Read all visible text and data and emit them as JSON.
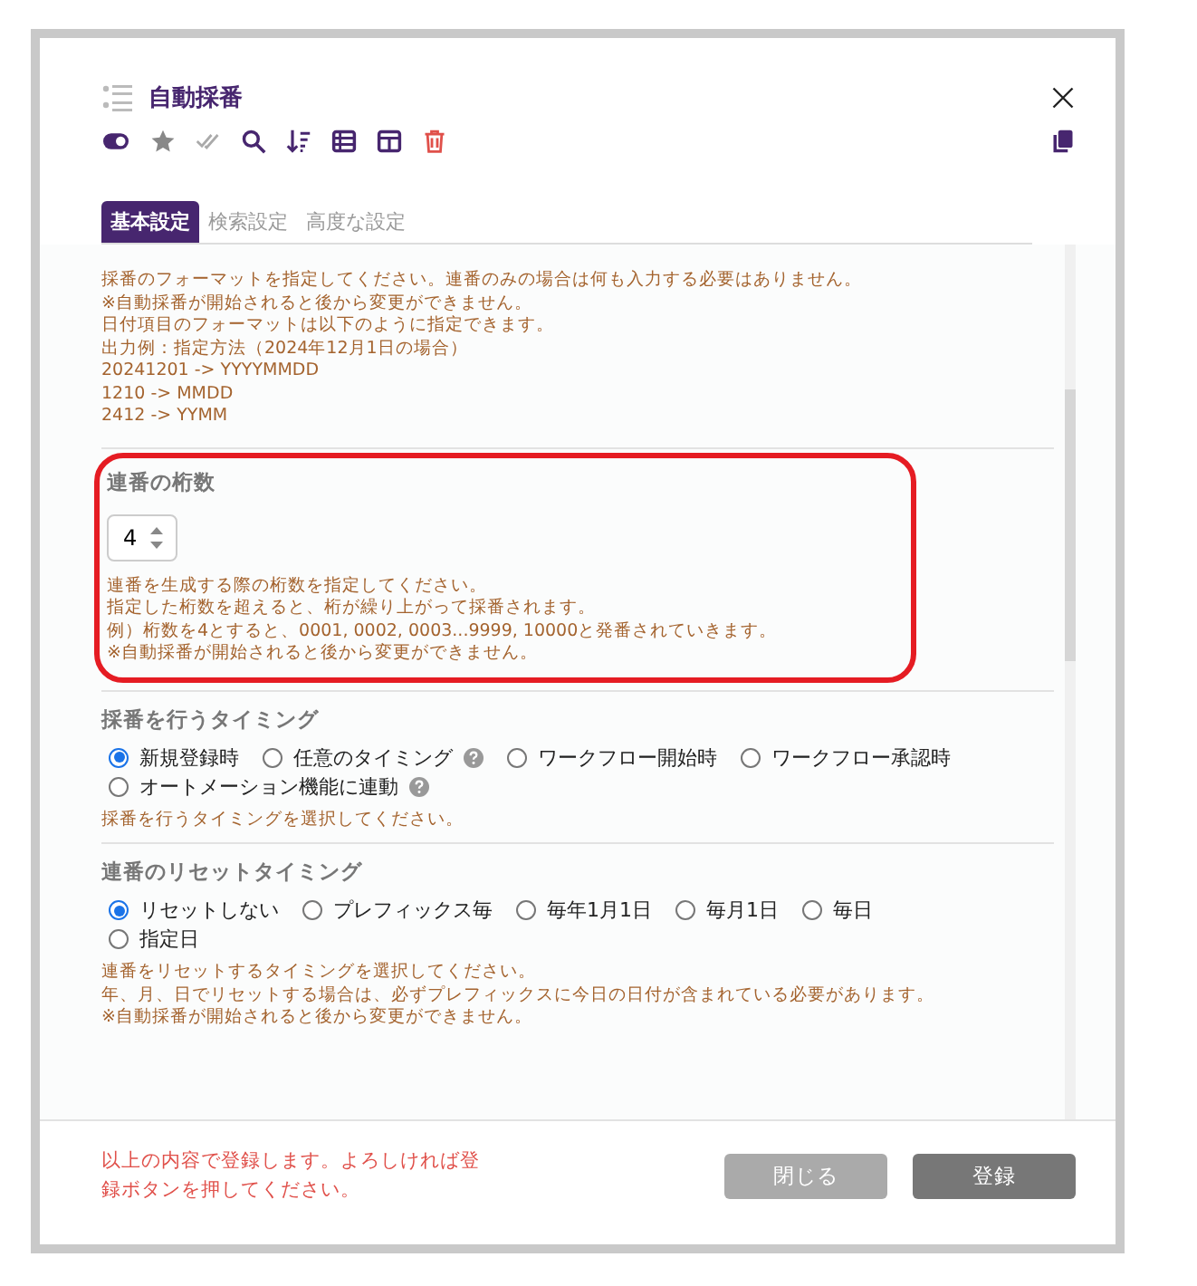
{
  "dialog": {
    "title": "自動採番"
  },
  "tabs": [
    {
      "label": "基本設定",
      "selected": true
    },
    {
      "label": "検索設定",
      "selected": false
    },
    {
      "label": "高度な設定",
      "selected": false
    }
  ],
  "format_help": [
    "採番のフォーマットを指定してください。連番のみの場合は何も入力する必要はありません。",
    "※自動採番が開始されると後から変更ができません。",
    "日付項目のフォーマットは以下のように指定できます。",
    "出力例：指定方法（2024年12月1日の場合）",
    "20241201 -> YYYYMMDD",
    "1210 -> MMDD",
    "2412 -> YYMM"
  ],
  "digits": {
    "label": "連番の桁数",
    "value": "4",
    "help": [
      "連番を生成する際の桁数を指定してください。",
      "指定した桁数を超えると、桁が繰り上がって採番されます。",
      "例）桁数を4とすると、0001, 0002, 0003...9999, 10000と発番されていきます。",
      "※自動採番が開始されると後から変更ができません。"
    ]
  },
  "timing": {
    "label": "採番を行うタイミング",
    "options": [
      {
        "label": "新規登録時",
        "selected": true,
        "help": false
      },
      {
        "label": "任意のタイミング",
        "selected": false,
        "help": true
      },
      {
        "label": "ワークフロー開始時",
        "selected": false,
        "help": false
      },
      {
        "label": "ワークフロー承認時",
        "selected": false,
        "help": false
      },
      {
        "label": "オートメーション機能に連動",
        "selected": false,
        "help": true
      }
    ],
    "help": [
      "採番を行うタイミングを選択してください。"
    ]
  },
  "reset": {
    "label": "連番のリセットタイミング",
    "options": [
      {
        "label": "リセットしない",
        "selected": true,
        "help": false
      },
      {
        "label": "プレフィックス毎",
        "selected": false,
        "help": false
      },
      {
        "label": "毎年1月1日",
        "selected": false,
        "help": false
      },
      {
        "label": "毎月1日",
        "selected": false,
        "help": false
      },
      {
        "label": "毎日",
        "selected": false,
        "help": false
      },
      {
        "label": "指定日",
        "selected": false,
        "help": false
      }
    ],
    "help": [
      "連番をリセットするタイミングを選択してください。",
      "年、月、日でリセットする場合は、必ずプレフィックスに今日の日付が含まれている必要があります。",
      "※自動採番が開始されると後から変更ができません。"
    ]
  },
  "footer": {
    "message": "以上の内容で登録します。よろしければ登録ボタンを押してください。",
    "buttons": [
      {
        "label": "閉じる",
        "kind": "secondary"
      },
      {
        "label": "登録",
        "kind": "primary"
      }
    ]
  }
}
